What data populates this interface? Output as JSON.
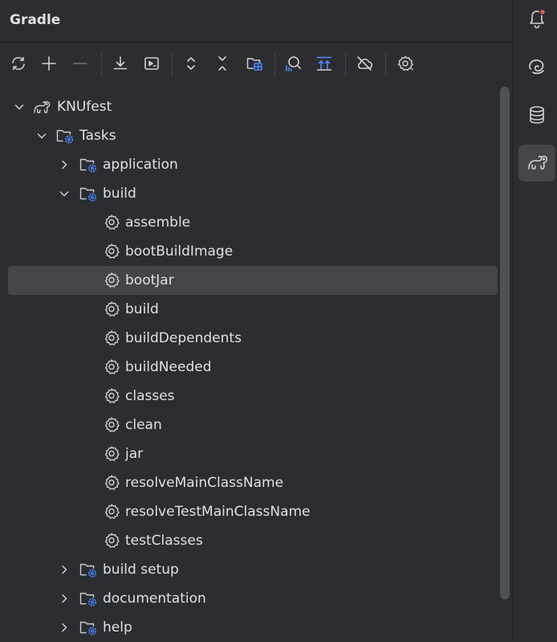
{
  "panel": {
    "title": "Gradle"
  },
  "toolbar": {
    "buttons": [
      {
        "name": "reload-all-icon"
      },
      {
        "name": "add-icon"
      },
      {
        "name": "remove-icon"
      },
      {
        "name": "download-sources-icon"
      },
      {
        "name": "run-task-icon"
      },
      {
        "name": "expand-all-icon"
      },
      {
        "name": "collapse-all-icon"
      },
      {
        "name": "group-modules-icon"
      },
      {
        "name": "analyze-dependencies-icon"
      },
      {
        "name": "toggle-offline-icon"
      },
      {
        "name": "offline-mode-icon"
      },
      {
        "name": "settings-icon"
      }
    ]
  },
  "tree": {
    "root": "KNUfest",
    "tasks": "Tasks",
    "groups": {
      "application": "application",
      "build": "build",
      "build_setup": "build setup",
      "documentation": "documentation",
      "help": "help"
    },
    "build_tasks": [
      "assemble",
      "bootBuildImage",
      "bootJar",
      "build",
      "buildDependents",
      "buildNeeded",
      "classes",
      "clean",
      "jar",
      "resolveMainClassName",
      "resolveTestMainClassName",
      "testClasses"
    ],
    "selected": "bootJar"
  },
  "rightbar": {
    "items": [
      {
        "name": "notifications-icon",
        "badge_color": "#e55757"
      },
      {
        "name": "ai-assistant-icon"
      },
      {
        "name": "database-icon"
      },
      {
        "name": "gradle-icon",
        "active": true
      }
    ]
  },
  "colors": {
    "background": "#2b2d30",
    "text": "#dfe1e5",
    "icon": "#ced0d6",
    "accent": "#548af7",
    "selection": "#43454a"
  }
}
